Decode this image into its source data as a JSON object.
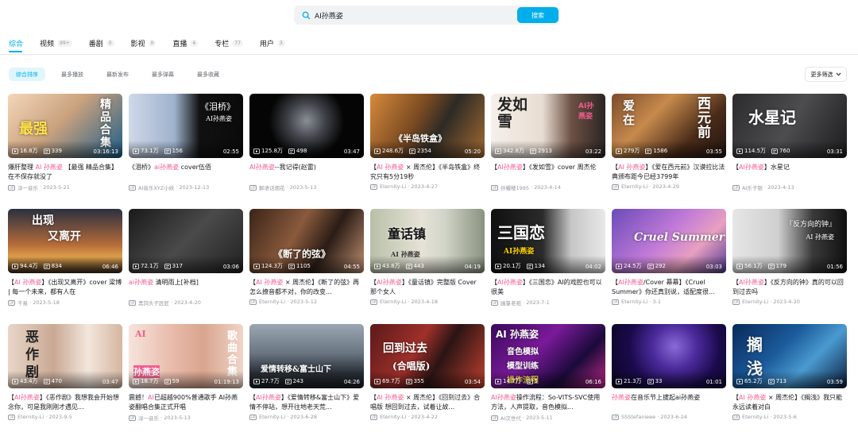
{
  "search": {
    "value": "AI孙燕姿",
    "button": "搜索"
  },
  "tabs": [
    {
      "label": "综合",
      "count": ""
    },
    {
      "label": "视频",
      "count": "99+"
    },
    {
      "label": "番剧",
      "count": "0"
    },
    {
      "label": "影视",
      "count": "0"
    },
    {
      "label": "直播",
      "count": "4"
    },
    {
      "label": "专栏",
      "count": "77"
    },
    {
      "label": "用户",
      "count": "3"
    }
  ],
  "sort": [
    "综合排序",
    "最多播放",
    "最新发布",
    "最多弹幕",
    "最多收藏"
  ],
  "filter_label": "更多筛选",
  "videos": [
    {
      "pre": "爆肝整理 ",
      "hl": "AI 孙燕姿",
      "post": " 【最强 精品合集】 在不保存就没了",
      "plays": "16.8万",
      "danmaku": "339",
      "duration": "03:16:13",
      "up": "淳一音乐",
      "date": "2023-5-21",
      "overlay": [
        "精品合集",
        "最强"
      ],
      "bg": "linear-gradient(135deg,#f3d7b9,#caa27e 45%,#1a5c88)"
    },
    {
      "pre": "《泪桥》",
      "hl": "ai孙燕姿",
      "post": " cover伍佰",
      "plays": "73.1万",
      "danmaku": "156",
      "duration": "02:55",
      "up": "AI音乐XYZ小妖",
      "date": "2023-12-13",
      "overlay": [
        "《泪桥》",
        "AI孙燕姿"
      ],
      "bg": "linear-gradient(90deg,#cfd8e8 0%,#9fb2cc 40%,#111 62%,#0a0a0a)"
    },
    {
      "pre": "",
      "hl": "AI孙燕姿",
      "post": "--我记得(赵雷)",
      "plays": "125.8万",
      "danmaku": "498",
      "duration": "03:47",
      "up": "解语话烟花",
      "date": "2023-5-13",
      "overlay": [],
      "bg": "radial-gradient(circle at 50% 42%,#8a8f96 0,#3d4046 28%,#050505 55%)"
    },
    {
      "pre": "【",
      "hl": "AI 孙燕姿",
      "post": " × 周杰伦】《半岛铁盒》终究只有5分19秒",
      "plays": "248.6万",
      "danmaku": "2354",
      "duration": "05:20",
      "up": "Eternity-Li",
      "date": "2023-4-27",
      "overlay": [
        "《半岛铁盒》"
      ],
      "bg": "linear-gradient(120deg,#d68a3b,#7a4a22 40%,#2d2a25 60%,#a56b33)"
    },
    {
      "pre": "【",
      "hl": "AI孙燕姿",
      "post": "】《发如雪》cover 周杰伦",
      "plays": "342.8万",
      "danmaku": "2913",
      "duration": "03:22",
      "up": "孙耀楼1995",
      "date": "2023-4-14",
      "overlay": [
        "发如雪",
        "AI孙燕姿"
      ],
      "bg": "linear-gradient(90deg,#f5f0ea 0%,#e9ddd2 45%,#6d5145 70%,#2b2523)"
    },
    {
      "pre": "【",
      "hl": "AI 孙燕姿",
      "post": "】《爱在西元前》汉谟拉比法典颁布距今已经3799年",
      "plays": "279万",
      "danmaku": "1586",
      "duration": "03:55",
      "up": "Eternity-Li",
      "date": "2023-4-29",
      "overlay": [
        "爱在",
        "西元前"
      ],
      "bg": "linear-gradient(135deg,#7a4a2a,#c78a4d 35%,#4a2b19 70%,#1f140e)"
    },
    {
      "pre": "【",
      "hl": "AI孙燕姿",
      "post": "】水星记",
      "plays": "114.5万",
      "danmaku": "760",
      "duration": "03:31",
      "up": "AI乐子银",
      "date": "2023-4-13",
      "overlay": [
        "水星记"
      ],
      "bg": "linear-gradient(120deg,#2b2b2e,#4d4c4f 50%,#1b1b1c)"
    },
    {
      "pre": "【",
      "hl": "AI 孙燕姿",
      "post": "】《出现又离开》cover 梁博 | 每一个未来，都有人在",
      "plays": "94.4万",
      "danmaku": "834",
      "duration": "06:46",
      "up": "千易",
      "date": "2023-5-18",
      "overlay": [
        "出现",
        "又离开"
      ],
      "bg": "linear-gradient(180deg,#2a3040 0%,#b36a3a 55%,#e0a04c 75%,#3a2a1e)"
    },
    {
      "pre": "",
      "hl": "ai孙燕姿",
      "post": " 清明雨上[补档]",
      "plays": "72.1万",
      "danmaku": "317",
      "duration": "03:06",
      "up": "黑鸽头子匠匠",
      "date": "2023-4-20",
      "overlay": [],
      "bg": "linear-gradient(135deg,#1a1a1a,#4a4a4a 50%,#202020)"
    },
    {
      "pre": "【",
      "hl": "AI 孙燕姿",
      "post": " × 周杰伦】《断了的弦》再怎么撩音都不对，你的改变...",
      "plays": "124.3万",
      "danmaku": "1105",
      "duration": "04:55",
      "up": "Eternity-Li",
      "date": "2023-5-12",
      "overlay": [
        "《断了的弦》"
      ],
      "bg": "linear-gradient(120deg,#3a2418,#8a5a3c 40%,#2a1c16 65%,#c09070)"
    },
    {
      "pre": "【",
      "hl": "AI孙燕姿",
      "post": "】《童话镇》完整版 Cover 那个女人",
      "plays": "43.8万",
      "danmaku": "443",
      "duration": "04:19",
      "up": "Eternity-Li",
      "date": "2023-4-18",
      "overlay": [
        "童话镇",
        "AI 孙燕姿"
      ],
      "bg": "linear-gradient(90deg,#b8c0a8,#e6e2d6 45%,#d0d5c8 65%,#8a9280)"
    },
    {
      "pre": "【",
      "hl": "AI孙燕姿",
      "post": "】《三国恋》AI的戏腔也可以很美",
      "plays": "20.1万",
      "danmaku": "134",
      "duration": "04:02",
      "up": "幽篁老祖",
      "date": "2023-7-1",
      "overlay": [
        "三国恋",
        "AI孙燕姿"
      ],
      "bg": "linear-gradient(90deg,#101010,#2a2a2a 45%,#c6c6c6 70%,#e8e8e8)"
    },
    {
      "pre": "【",
      "hl": "AI孙燕姿",
      "post": "/Cover 幕幕】《Cruel Summer》你还真别说，适配度很...",
      "plays": "24.5万",
      "danmaku": "292",
      "duration": "03:03",
      "up": "Eternity-Li",
      "date": "3-1",
      "overlay": [
        "Cruel Summer"
      ],
      "bg": "linear-gradient(135deg,#6a4bb8,#c07ad8 45%,#e8a0c0 70%,#503a90)"
    },
    {
      "pre": "【",
      "hl": "AI孙燕姿",
      "post": "】《反方向的钟》真的可以回到过去吗",
      "plays": "56.1万",
      "danmaku": "179",
      "duration": "01:56",
      "up": "Eternity-Li",
      "date": "2023-4-20",
      "overlay": [
        "『反方向的钟』",
        "AI 孙燕姿"
      ],
      "bg": "linear-gradient(90deg,#e6e6e6,#cfcfcf 40%,#3a3a3a 70%,#101010)"
    },
    {
      "pre": "【",
      "hl": "AI孙燕姿",
      "post": "】《恶作剧》我想我会开始想念你，可是我刚刚才遇见...",
      "plays": "43.4万",
      "danmaku": "470",
      "duration": "03:47",
      "up": "Eternity-Li",
      "date": "2023-9-5",
      "overlay": [
        "恶",
        "作",
        "剧"
      ],
      "bg": "linear-gradient(90deg,#e8d6c8,#c9a994 40%,#f2e6dc 70%,#d6b6a0)"
    },
    {
      "pre": "震撼！",
      "hl": "AI",
      "post": "已超越900%普通歌手 AI孙燕姿翻唱合集正式开唱",
      "plays": "18.7万",
      "danmaku": "59",
      "duration": "01:19:13",
      "up": "淳一音乐",
      "date": "2023-5-13",
      "overlay": [
        "AI",
        "孙燕姿",
        "歌曲合集"
      ],
      "bg": "linear-gradient(90deg,#f6e4dc,#e8b9a8 40%,#d9a58e 65%,#f0d5c8)"
    },
    {
      "pre": "【",
      "hl": "AI孙燕姿",
      "post": "】《爱情转移&富士山下》爱情不停站，想开往地老天荒...",
      "plays": "27.7万",
      "danmaku": "243",
      "duration": "04:26",
      "up": "Eternity-Li",
      "date": "2023-6-28",
      "overlay": [
        "爱情转移&富士山下"
      ],
      "bg": "linear-gradient(180deg,#9aa6b2,#6a7682 45%,#2a3038 75%,#1a1e22)"
    },
    {
      "pre": "【",
      "hl": "AI 孙燕姿",
      "post": " × 周杰伦】《回到过去》合唱版 想回到过去，试着让故...",
      "plays": "69.7万",
      "danmaku": "355",
      "duration": "03:54",
      "up": "Eternity-Li",
      "date": "2023-4-22",
      "overlay": [
        "回到过去",
        "(合唱版)"
      ],
      "bg": "linear-gradient(120deg,#5a1a1a,#a0302a 40%,#2a1414 60%,#c04030)"
    },
    {
      "pre": "",
      "hl": "AI孙燕姿",
      "post": "操作流程：So-VITS-SVC使用方法，人声提取，音色模拟...",
      "plays": "14.7万",
      "danmaku": "5",
      "duration": "06:16",
      "up": "AI次世代",
      "date": "2023-5-11",
      "overlay": [
        "AI 孙燕姿",
        "音色模拟",
        "模型训练",
        "操作流程"
      ],
      "bg": "linear-gradient(135deg,#3a0a5a,#7a1a9a 40%,#1a0a3a 70%,#c02a8a)"
    },
    {
      "pre": "",
      "hl": "孙燕姿",
      "post": "在音乐节上拔起ai孙燕姿",
      "plays": "21.3万",
      "danmaku": "33",
      "duration": "01:01",
      "up": "SSStefanieee",
      "date": "2023-6-24",
      "overlay": [],
      "bg": "radial-gradient(circle at 55% 35%,#8a6ad8 0,#4a2a9a 30%,#1a0a4a 60%,#0a0520)"
    },
    {
      "pre": "【",
      "hl": "AI 孙燕姿",
      "post": " × 周杰伦】《搁浅》我只能永远读着对白",
      "plays": "65.2万",
      "danmaku": "713",
      "duration": "03:59",
      "up": "Eternity-Li",
      "date": "2023-5-6",
      "overlay": [
        "搁",
        "浅"
      ],
      "bg": "linear-gradient(135deg,#0a2a5a,#1a5a9a 40%,#4a9ad0 65%,#0a1a3a)"
    }
  ]
}
